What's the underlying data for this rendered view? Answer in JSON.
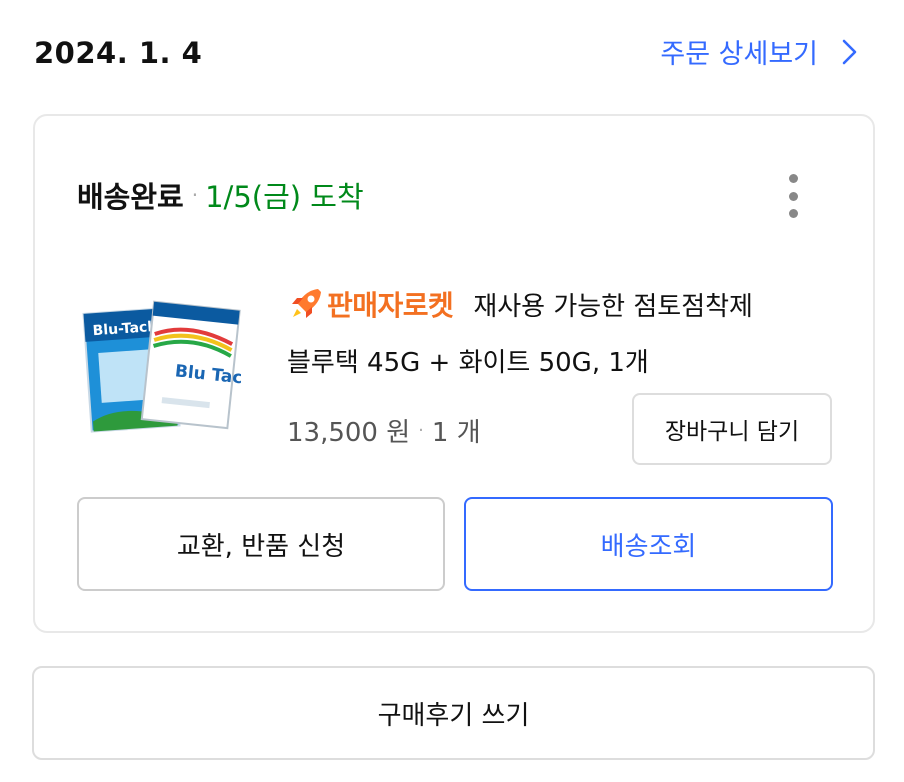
{
  "order": {
    "date": "2024. 1. 4",
    "detail_link_label": "주문 상세보기"
  },
  "delivery": {
    "status": "배송완료",
    "separator": "·",
    "arrival": "1/5(금) 도착"
  },
  "product": {
    "badge": "판매자로켓",
    "name_line1": "재사용 가능한 점토점착제",
    "name_line2": "블루택 45G + 화이트 50G, 1개",
    "price": "13,500 원",
    "separator": "·",
    "quantity": "1 개",
    "image_text_a": "Blu-Tack",
    "image_text_b": "Blu Tack"
  },
  "buttons": {
    "add_to_cart": "장바구니 담기",
    "exchange_return": "교환, 반품 신청",
    "track_delivery": "배송조회",
    "write_review": "구매후기 쓰기"
  },
  "colors": {
    "accent_blue": "#346aff",
    "arrival_green": "#00891a",
    "badge_orange": "#f37021"
  },
  "icons": {
    "detail": "chevron-right-icon",
    "menu": "kebab-menu-icon",
    "badge": "rocket-icon"
  }
}
